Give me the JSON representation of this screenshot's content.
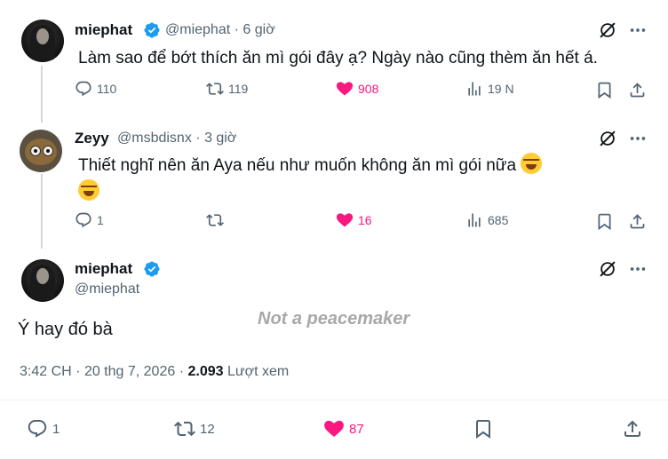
{
  "tweets": [
    {
      "display_name": "miephat",
      "handle": "@miephat",
      "time": "6 giờ",
      "text": "Làm sao để bớt thích ăn mì gói đây ạ? Ngày nào cũng thèm ăn hết á.",
      "replies": "110",
      "retweets": "119",
      "likes": "908",
      "views": "19 N"
    },
    {
      "display_name": "Zeyy",
      "handle": "@msbdisnx",
      "time": "3 giờ",
      "text": "Thiết nghĩ nên ăn Aya nếu như muốn không ăn mì gói nữa",
      "replies": "1",
      "retweets": "",
      "likes": "16",
      "views": "685"
    }
  ],
  "main_tweet": {
    "display_name": "miephat",
    "handle": "@miephat",
    "text": "Ý hay đó bà",
    "time": "3:42 CH",
    "date": "20 thg 7, 2026",
    "views_count": "2.093",
    "views_label": "Lượt xem",
    "replies": "1",
    "retweets": "12",
    "likes": "87"
  },
  "watermark": "Not a peacemaker",
  "separator": "·",
  "colors": {
    "like": "#f91880",
    "verified": "#1d9bf0",
    "muted": "#536471"
  },
  "icons": [
    "verified-badge-icon",
    "grok-icon",
    "more-icon",
    "reply-icon",
    "retweet-icon",
    "heart-icon",
    "views-icon",
    "bookmark-icon",
    "share-icon",
    "laughing-emoji-icon"
  ]
}
